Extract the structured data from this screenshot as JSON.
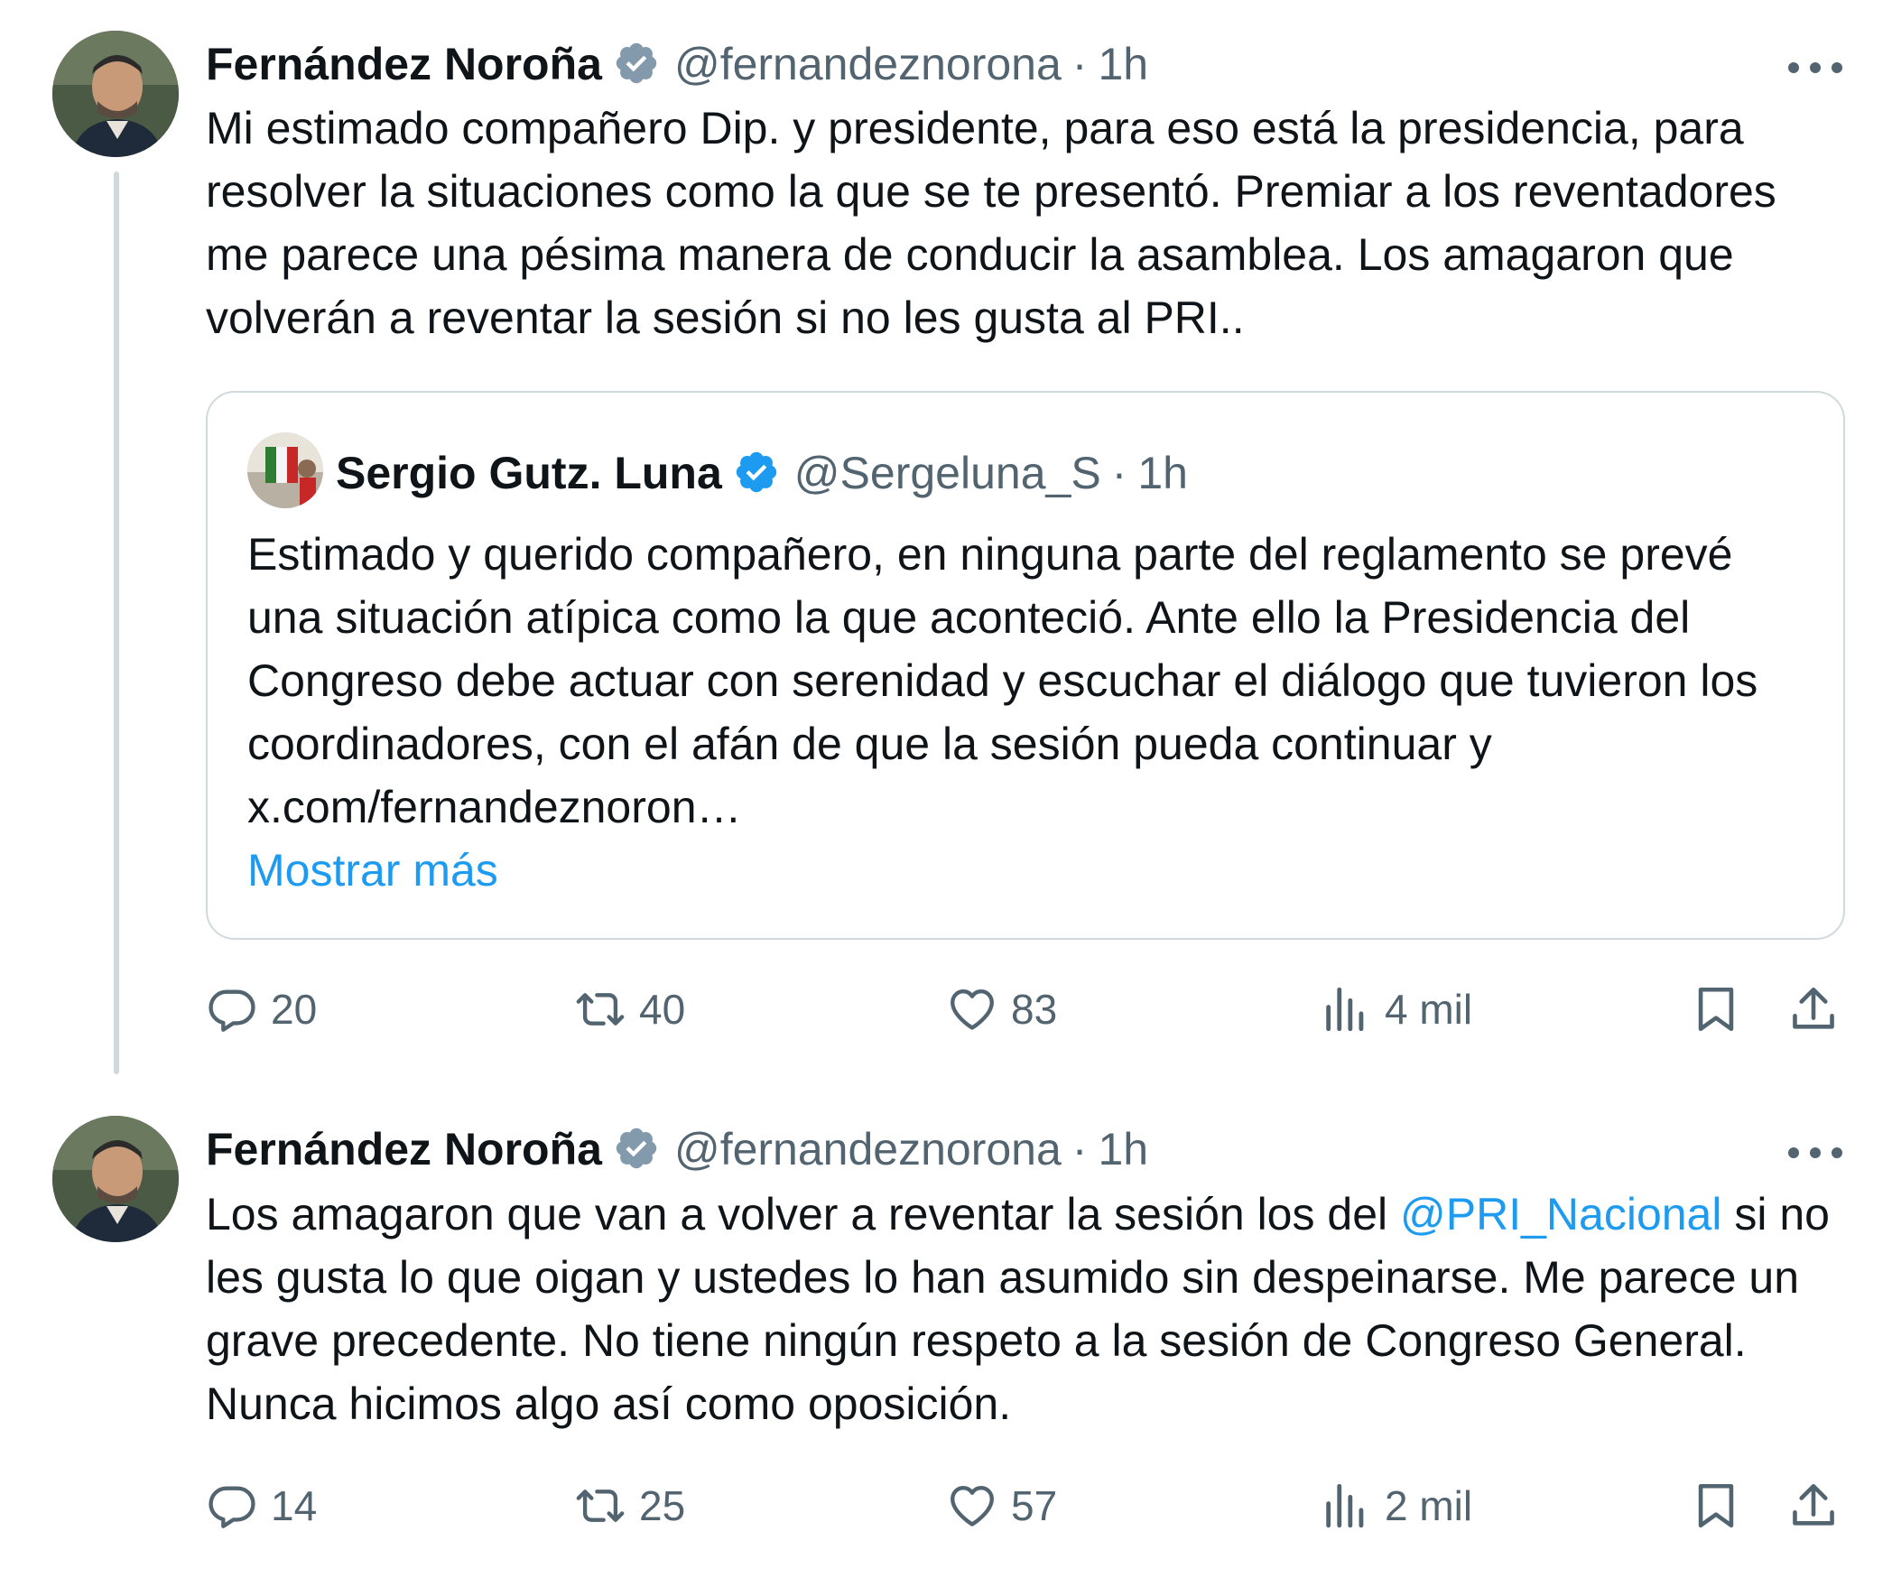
{
  "tweets": [
    {
      "author": "Fernández Noroña",
      "handle": "@fernandeznorona",
      "separator": "·",
      "time": "1h",
      "text": "Mi estimado compañero Dip. y presidente, para eso está la presidencia, para resolver la situaciones como la que se te presentó. Premiar a los reventadores me parece una pésima manera de conducir la asamblea. Los amagaron que volverán a reventar la sesión si no les gusta al PRI..",
      "quote": {
        "author": "Sergio Gutz. Luna",
        "handle": "@Sergeluna_S",
        "separator": "·",
        "time": "1h",
        "text": "Estimado y querido compañero, en ninguna parte del reglamento se prevé una situación atípica como la que aconteció. Ante ello la Presidencia del Congreso debe actuar con serenidad y escuchar el diálogo que tuvieron los coordinadores, con el afán de que la sesión pueda continuar y x.com/fernandeznoron…",
        "show_more": "Mostrar más"
      },
      "stats": {
        "replies": "20",
        "reposts": "40",
        "likes": "83",
        "views": "4 mil"
      }
    },
    {
      "author": "Fernández Noroña",
      "handle": "@fernandeznorona",
      "separator": "·",
      "time": "1h",
      "text_before": "Los amagaron que van a volver a reventar la sesión los del ",
      "mention": "@PRI_Nacional",
      "text_after": " si no les gusta lo que oigan y ustedes lo han asumido sin despeinarse. Me parece un grave precedente. No tiene ningún respeto a la sesión de Congreso General. Nunca hicimos algo así como oposición.",
      "stats": {
        "replies": "14",
        "reposts": "25",
        "likes": "57",
        "views": "2 mil"
      }
    }
  ],
  "colors": {
    "text": "#0f1419",
    "secondary": "#536471",
    "accent": "#1d9bf0",
    "border": "#cfd9de"
  },
  "icons": [
    "verified-badge-icon",
    "more-options-icon",
    "reply-icon",
    "repost-icon",
    "like-icon",
    "views-icon",
    "bookmark-icon",
    "share-icon"
  ]
}
